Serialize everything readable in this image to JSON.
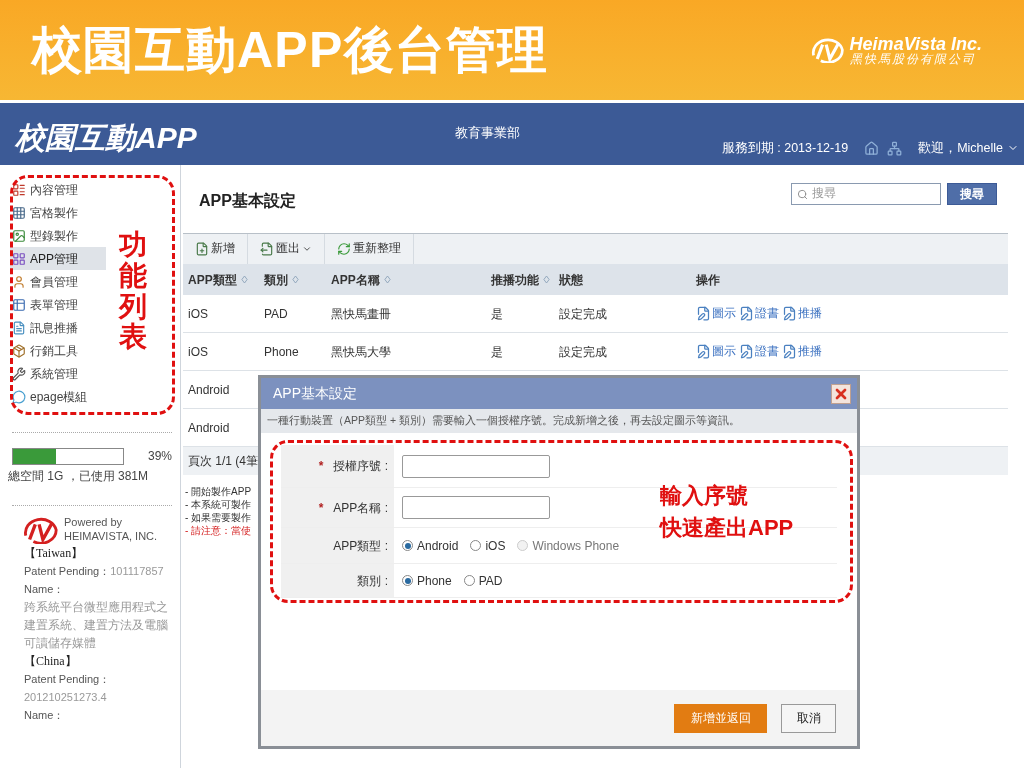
{
  "slide": {
    "title": "校園互動APP後台管理",
    "company": {
      "name": "HeimaVista Inc.",
      "name_local": "黑快馬股份有限公司"
    }
  },
  "header": {
    "logo": "校園互動APP",
    "department": "教育事業部",
    "expiry": "服務到期 : 2013-12-19",
    "user": "歡迎，Michelle"
  },
  "sidebar": {
    "items": [
      {
        "label": "內容管理",
        "selected": false
      },
      {
        "label": "宮格製作",
        "selected": false
      },
      {
        "label": "型錄製作",
        "selected": false
      },
      {
        "label": "APP管理",
        "selected": true
      },
      {
        "label": "會員管理",
        "selected": false
      },
      {
        "label": "表單管理",
        "selected": false
      },
      {
        "label": "訊息推播",
        "selected": false
      },
      {
        "label": "行銷工具",
        "selected": false
      },
      {
        "label": "系統管理",
        "selected": false
      },
      {
        "label": "epage模組",
        "selected": false
      }
    ],
    "storage": {
      "level": 0.39,
      "percent": "39%",
      "text": "總空間 1G ，已使用 381M"
    },
    "powered_by": {
      "line1": "Powered by",
      "line2": "HEIMAVISTA, INC."
    },
    "patents": [
      {
        "region": "【Taiwan】",
        "pending_label": "Patent Pending：",
        "number": "101117857",
        "name_label": "Name：",
        "name": "跨系統平台微型應用程式之建置系統、建置方法及電腦可讀儲存媒體"
      },
      {
        "region": "【China】",
        "pending_label": "Patent Pending：",
        "number": "201210251273.4",
        "name_label": "Name："
      }
    ]
  },
  "main": {
    "title": "APP基本設定",
    "search": {
      "placeholder": "搜尋",
      "button": "搜尋"
    },
    "toolbar": [
      "新增",
      "匯出",
      "重新整理"
    ],
    "table": {
      "columns": [
        {
          "label": "APP類型",
          "sortable": true
        },
        {
          "label": "類別",
          "sortable": true
        },
        {
          "label": "APP名稱",
          "sortable": true
        },
        {
          "label": "推播功能",
          "sortable": true
        },
        {
          "label": "狀態",
          "sortable": false
        },
        {
          "label": "操作",
          "sortable": false
        }
      ],
      "rows": [
        {
          "app_type": "iOS",
          "category": "PAD",
          "name": "黑快馬畫冊",
          "push": "是",
          "status": "設定完成",
          "actions": [
            "圖示",
            "證書",
            "推播"
          ]
        },
        {
          "app_type": "iOS",
          "category": "Phone",
          "name": "黑快馬大學",
          "push": "是",
          "status": "設定完成",
          "actions": [
            "圖示",
            "證書",
            "推播"
          ]
        },
        {
          "app_type": "Android"
        },
        {
          "app_type": "Android"
        }
      ]
    },
    "pager": "頁次 1/1 (4筆",
    "notes": [
      {
        "text": "- 開始製作APP",
        "kind": "normal"
      },
      {
        "text": "- 本系統可製作",
        "kind": "normal"
      },
      {
        "text": "- 如果需要製作",
        "kind": "normal"
      },
      {
        "text": "- 請注意：當使",
        "kind": "warning"
      }
    ]
  },
  "dialog": {
    "title": "APP基本設定",
    "hint": "一種行動裝置（APP類型 + 類別）需要輸入一個授權序號。完成新增之後，再去設定圖示等資訊。",
    "fields": [
      {
        "kind": "text",
        "label": "授權序號 :",
        "required_mark": "*"
      },
      {
        "kind": "text",
        "label": "APP名稱 :",
        "required_mark": "*"
      },
      {
        "kind": "radio",
        "label": "APP類型 :",
        "options": [
          {
            "label": "Android",
            "selected": true,
            "disabled": false
          },
          {
            "label": "iOS",
            "selected": false,
            "disabled": false
          },
          {
            "label": "Windows Phone",
            "selected": false,
            "disabled": true
          }
        ]
      },
      {
        "kind": "radio",
        "label": "類別 :",
        "options": [
          {
            "label": "Phone",
            "selected": true,
            "disabled": false
          },
          {
            "label": "PAD",
            "selected": false,
            "disabled": false
          }
        ]
      }
    ],
    "buttons": [
      {
        "label": "新增並返回",
        "kind": "primary"
      },
      {
        "label": "取消",
        "kind": "secondary"
      }
    ]
  },
  "annotations": [
    {
      "lines": [
        "功能列表"
      ],
      "kind": "vertical"
    },
    {
      "lines": [
        "輸入序號",
        "快速產出APP"
      ],
      "kind": "horizontal"
    }
  ]
}
